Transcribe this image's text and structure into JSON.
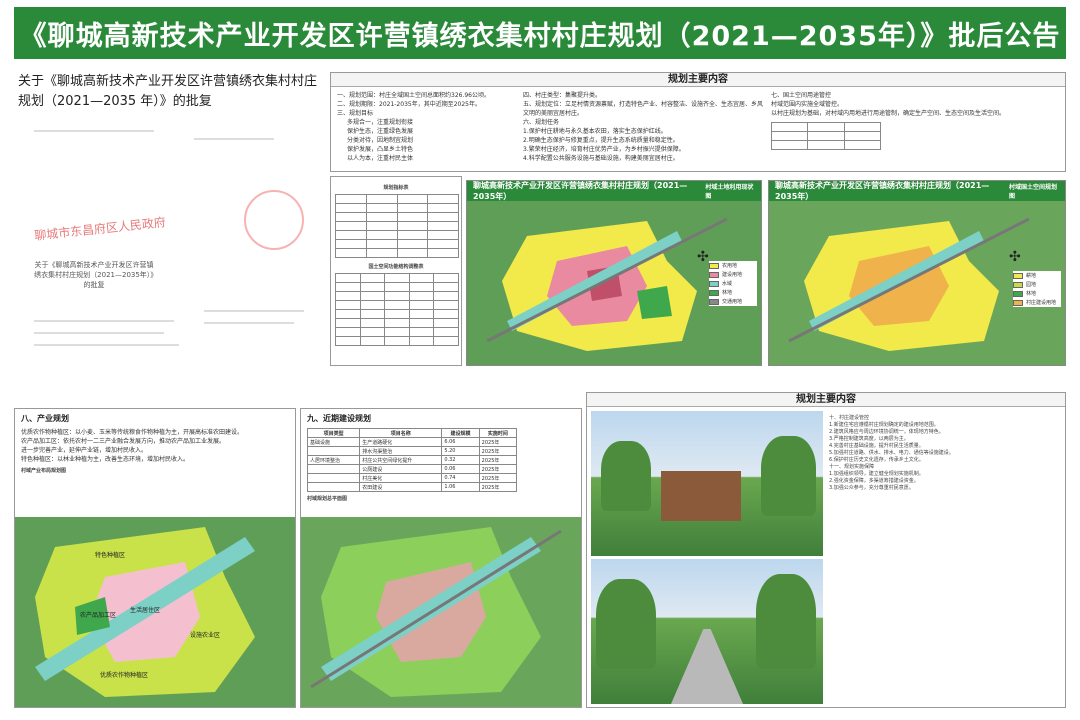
{
  "header": {
    "title": "《聊城高新技术产业开发区许营镇绣衣集村村庄规划（2021—2035年）》批后公告"
  },
  "approval_doc": {
    "heading": "关于《聊城高新技术产业开发区许营镇绣衣集村村庄规划（2021—2035 年）》的批复",
    "seal_text": "聊城市东昌府区人民政府",
    "inner_title": "关于《聊城高新技术产业开发区许营镇绣衣集村村庄规划（2021—2035年）》的批复"
  },
  "main_content": {
    "title": "规划主要内容",
    "col1": [
      "一、规划范围：村庄全域国土空间总面积约326.96公顷。",
      "二、规划期限：2021-2035年，其中近期至2025年。",
      "三、规划目标",
      "多规合一，注重规划衔接",
      "保护生态，注重绿色发展",
      "分类对待，因地制宜规划",
      "保护发展，凸显乡土特色",
      "以人为本，注重村民主体"
    ],
    "col2": [
      "四、村庄类型：集聚提升类。",
      "五、规划定位：立足村情资源禀赋，打造特色产业、村容整洁、设施齐全、生态宜居、乡风文明的美丽宜居村庄。",
      "六、规划任务",
      "1.保护村庄耕地与永久基本农田，落实生态保护红线。",
      "2.明确生态保护与修复重点，提升生态系统质量和稳定性。",
      "3.繁荣村庄经济，培育村庄优势产业，为乡村振兴提供保障。",
      "4.科学配置公共服务设施与基础设施，构建美丽宜居村庄。"
    ],
    "col3": [
      "七、国土空间用途管控",
      "村域范围内实施全域管控。",
      "以村庄规划为基础，对村域内用地进行用途管制，确定生产空间、生态空间及生活空间。"
    ]
  },
  "current_map": {
    "title": "聊城高新技术产业开发区许营镇绣衣集村村庄规划（2021—2035年）",
    "subtitle": "村域土地利用现状图",
    "legend": [
      "农用地",
      "建设用地",
      "水域",
      "林地",
      "交通用地"
    ]
  },
  "plan_map": {
    "title": "聊城高新技术产业开发区许营镇绣衣集村村庄规划（2021—2035年）",
    "subtitle": "村域国土空间规划图",
    "legend": [
      "耕地",
      "园地",
      "林地",
      "村庄建设用地"
    ]
  },
  "mid_left_tables": {
    "title1": "规划指标表",
    "title2": "国土空间功能结构调整表"
  },
  "industry": {
    "title": "八、产业规划",
    "items": [
      "优质农作物种植区：以小麦、玉米等传统粮食作物种植为主，开展高标准农田建设。",
      "农产品加工区：依托农村一二三产业融合发展方向，推动农产品加工业发展。",
      "进一步完善产业，延伸产业链，增加村民收入。",
      "特色种植区：以林业种植为主，改善生态环境，增加村民收入。"
    ],
    "map_title": "村域产业布局规划图",
    "zones": [
      "特色种植区",
      "农产品加工区",
      "生活居住区",
      "优质农作物种植区",
      "设施农业区"
    ]
  },
  "near_term": {
    "title": "九、近期建设规划",
    "headers": [
      "项目类型",
      "项目名称",
      "建设规模",
      "实施时间"
    ],
    "rows": [
      [
        "基础设施",
        "生产道路硬化",
        "6.06",
        "2025年"
      ],
      [
        "",
        "排水沟渠整治",
        "5.20",
        "2025年"
      ],
      [
        "人居环境整治",
        "村庄公共空间绿化提升",
        "0.32",
        "2025年"
      ],
      [
        "",
        "公厕建设",
        "0.06",
        "2025年"
      ],
      [
        "",
        "村庄美化",
        "0.74",
        "2025年"
      ],
      [
        "",
        "农田建设",
        "1.06",
        "2025年"
      ]
    ],
    "map_title": "村域规划总平面图"
  },
  "renderings": {
    "title": "规划主要内容",
    "notes": [
      "十、村庄建设管控",
      "1.新建住宅应遵循村庄规划确定的建设用地范围。",
      "2.建筑风格应与周边环境协调统一，体现地方特色。",
      "3.严格控制建筑高度，以两层为主。",
      "4.完善村庄基础设施，提升村民生活质量。",
      "5.加强村庄道路、供水、排水、电力、通信等设施建设。",
      "6.保护村庄历史文化遗存，传承乡土文化。",
      "十一、规划实施保障",
      "1.加强组织领导，建立健全规划实施机制。",
      "2.强化资金保障，多渠道筹措建设资金。",
      "3.加强公众参与，充分尊重村民意愿。"
    ]
  },
  "colors": {
    "header_green": "#2a8a3a",
    "farmland_yellow": "#f2ea4a",
    "village_pink": "#e98aa0",
    "forest_green": "#3fa84c",
    "road_gray": "#888888",
    "water_teal": "#7cd0c6"
  }
}
